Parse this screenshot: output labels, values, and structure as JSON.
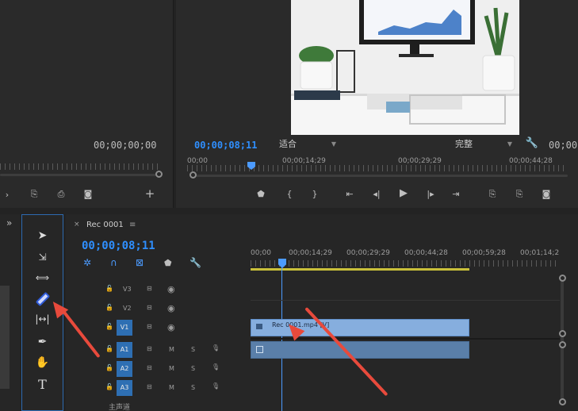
{
  "source_monitor": {
    "timecode": "00;00;00;00"
  },
  "program_monitor": {
    "timecode": "00;00;08;11",
    "fit_select": "适合",
    "quality_select": "完整",
    "timecode_right": "00;00",
    "ruler_ticks": [
      "00;00",
      "00;00;14;29",
      "00;00;29;29",
      "00;00;44;28"
    ]
  },
  "timeline": {
    "sequence_name": "Rec 0001",
    "timecode": "00;00;08;11",
    "ruler_ticks": [
      "00;00",
      "00;00;14;29",
      "00;00;29;29",
      "00;00;44;28",
      "00;00;59;28",
      "00;01;14;2"
    ],
    "video_tracks": [
      "V3",
      "V2",
      "V1"
    ],
    "audio_tracks": [
      "A1",
      "A2",
      "A3"
    ],
    "mute_label": "M",
    "solo_label": "S",
    "clip_label": "Rec 0001.mp4 [V]",
    "master_label": "主声道"
  },
  "tools": {
    "type_tool": "T"
  },
  "panel_menu_chevron": "»"
}
